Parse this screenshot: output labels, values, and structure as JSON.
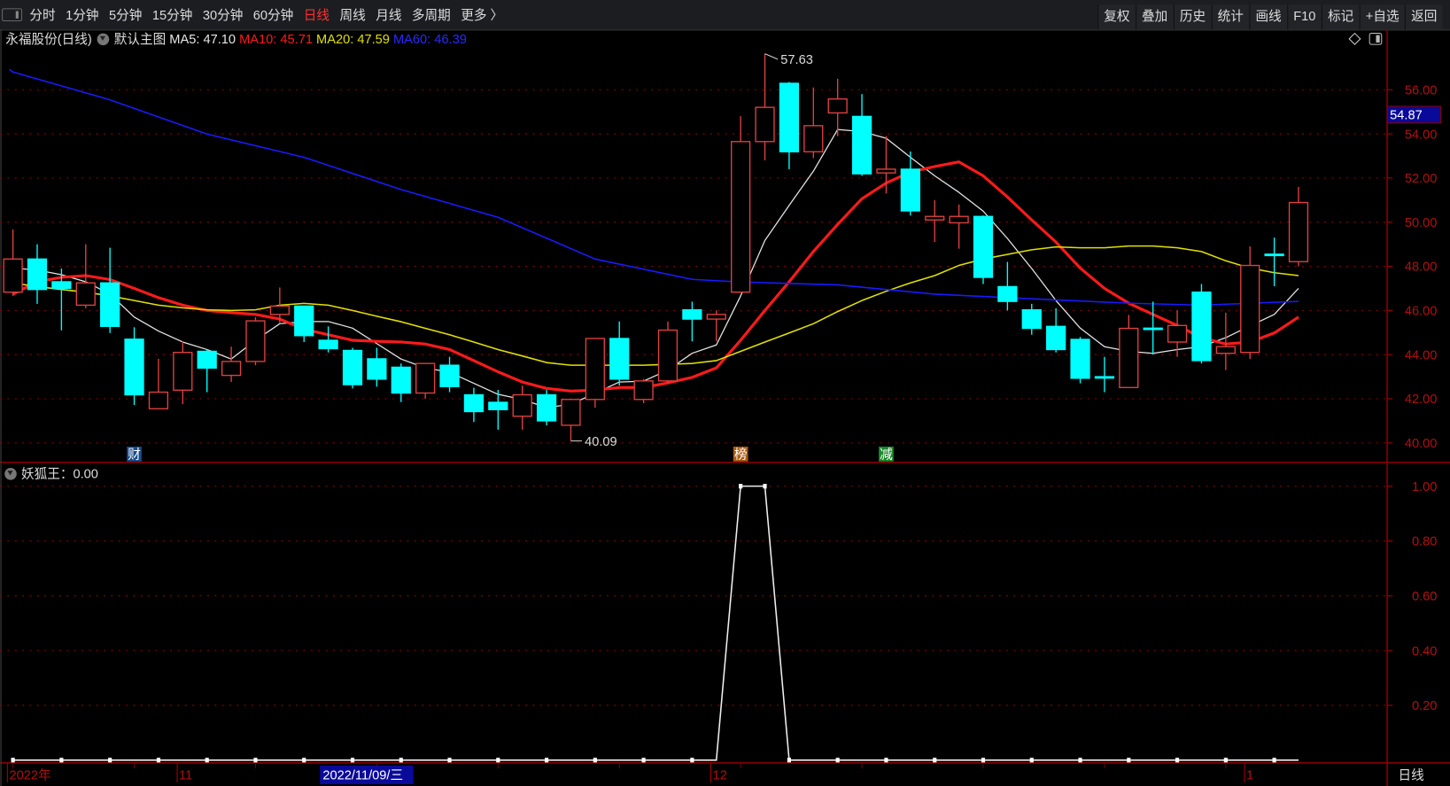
{
  "toolbar": {
    "periods": [
      "分时",
      "1分钟",
      "5分钟",
      "15分钟",
      "30分钟",
      "60分钟",
      "日线",
      "周线",
      "月线",
      "多周期",
      "更多 〉"
    ],
    "active_period": "日线",
    "buttons": [
      "复权",
      "叠加",
      "历史",
      "统计",
      "画线",
      "F10",
      "标记",
      "+自选",
      "返回"
    ]
  },
  "info": {
    "title": "永福股份(日线)",
    "template": "默认主图",
    "ma5": "MA5: 47.10",
    "ma10": "MA10: 45.71",
    "ma20": "MA20: 47.59",
    "ma60": "MA60: 46.39"
  },
  "indicator": {
    "label": "妖狐王：0.00"
  },
  "colors": {
    "up": "#e04040",
    "down": "#00ffff",
    "ma5": "#e6e6e6",
    "ma10": "#ff1a1a",
    "ma20": "#e0e000",
    "ma60": "#1a1aff",
    "grid": "#8b0000"
  },
  "chart_data": [
    {
      "type": "candlestick",
      "title": "永福股份(日线)",
      "ylim": [
        40,
        57
      ],
      "yticks": [
        "56.00",
        "54.00",
        "52.00",
        "50.00",
        "48.00",
        "46.00",
        "44.00",
        "42.00",
        "40.00"
      ],
      "current_price_tag": "54.87",
      "annotations": {
        "high": "57.63",
        "low": "40.09",
        "high_index": 31,
        "low_index": 23
      },
      "markers": [
        {
          "index": 5,
          "text": "财",
          "color": "#1a4a8a"
        },
        {
          "index": 30,
          "text": "榜",
          "color": "#b05a10"
        },
        {
          "index": 36,
          "text": "减",
          "color": "#1a8a2a"
        }
      ],
      "ohlc": [
        [
          46.83,
          49.67,
          46.66,
          48.33
        ],
        [
          48.33,
          49.0,
          46.3,
          46.95
        ],
        [
          47.3,
          47.9,
          45.1,
          47.0
        ],
        [
          46.24,
          49.0,
          46.1,
          47.25
        ],
        [
          47.25,
          48.84,
          44.98,
          45.28
        ],
        [
          44.7,
          45.24,
          41.72,
          42.18
        ],
        [
          41.55,
          43.81,
          41.55,
          42.3
        ],
        [
          42.39,
          44.6,
          41.76,
          44.1
        ],
        [
          44.15,
          44.23,
          42.3,
          43.39
        ],
        [
          43.06,
          44.36,
          42.76,
          43.69
        ],
        [
          43.69,
          45.7,
          43.52,
          45.53
        ],
        [
          45.82,
          47.04,
          45.4,
          46.2
        ],
        [
          46.2,
          46.2,
          44.57,
          44.86
        ],
        [
          44.65,
          45.28,
          44.1,
          44.27
        ],
        [
          44.19,
          44.31,
          42.47,
          42.64
        ],
        [
          43.81,
          44.31,
          42.55,
          42.89
        ],
        [
          43.43,
          43.6,
          41.85,
          42.26
        ],
        [
          42.26,
          43.6,
          42.0,
          43.6
        ],
        [
          43.52,
          43.9,
          42.3,
          42.55
        ],
        [
          42.18,
          42.5,
          40.95,
          41.42
        ],
        [
          41.84,
          42.4,
          40.6,
          41.51
        ],
        [
          41.21,
          42.6,
          40.6,
          42.18
        ],
        [
          42.18,
          42.4,
          40.8,
          41.0
        ],
        [
          40.8,
          41.9,
          40.09,
          41.97
        ],
        [
          41.97,
          44.73,
          41.6,
          44.73
        ],
        [
          44.73,
          45.5,
          42.6,
          42.89
        ],
        [
          41.97,
          42.9,
          41.8,
          42.81
        ],
        [
          42.81,
          45.5,
          42.7,
          45.11
        ],
        [
          46.03,
          46.4,
          44.6,
          45.61
        ],
        [
          45.61,
          46.0,
          44.6,
          45.82
        ],
        [
          46.83,
          54.8,
          46.83,
          53.65
        ],
        [
          53.65,
          57.63,
          52.8,
          55.2
        ],
        [
          56.29,
          56.35,
          52.4,
          53.19
        ],
        [
          53.19,
          56.1,
          52.9,
          54.37
        ],
        [
          54.95,
          56.5,
          53.9,
          55.58
        ],
        [
          54.79,
          55.8,
          52.1,
          52.19
        ],
        [
          52.23,
          53.9,
          51.3,
          52.4
        ],
        [
          52.4,
          53.2,
          50.3,
          50.51
        ],
        [
          50.1,
          51.0,
          49.1,
          50.26
        ],
        [
          49.97,
          50.8,
          48.8,
          50.26
        ],
        [
          50.26,
          50.3,
          47.2,
          47.5
        ],
        [
          47.08,
          48.2,
          46.0,
          46.41
        ],
        [
          46.03,
          46.3,
          44.9,
          45.19
        ],
        [
          45.28,
          46.1,
          44.1,
          44.23
        ],
        [
          44.69,
          44.8,
          42.7,
          42.93
        ],
        [
          43.0,
          43.9,
          42.3,
          42.95
        ],
        [
          42.51,
          45.8,
          42.51,
          45.19
        ],
        [
          45.2,
          46.4,
          44.0,
          45.15
        ],
        [
          44.57,
          46.0,
          43.9,
          45.32
        ],
        [
          46.83,
          47.2,
          43.6,
          43.73
        ],
        [
          44.06,
          45.9,
          43.3,
          44.36
        ],
        [
          44.1,
          48.9,
          43.8,
          48.04
        ],
        [
          48.55,
          49.3,
          47.1,
          48.5
        ],
        [
          48.21,
          51.6,
          48.0,
          50.89
        ]
      ],
      "series": [
        {
          "name": "MA5",
          "values": [
            47.92,
            47.83,
            47.62,
            47.3,
            46.74,
            45.7,
            45.07,
            44.57,
            44.23,
            43.8,
            44.65,
            45.4,
            45.5,
            45.5,
            45.2,
            44.5,
            43.8,
            43.4,
            43.2,
            42.7,
            42.2,
            41.97,
            41.6,
            41.75,
            42.25,
            42.76,
            42.8,
            43.3,
            44.06,
            44.44,
            46.66,
            49.17,
            50.76,
            52.31,
            54.2,
            54.1,
            53.8,
            52.94,
            52.1,
            51.35,
            50.5,
            49.26,
            47.9,
            46.45,
            45.2,
            44.36,
            44.15,
            44.06,
            44.23,
            44.36,
            44.77,
            45.3,
            45.82,
            47.0
          ]
        },
        {
          "name": "MA10",
          "values": [
            46.74,
            47.3,
            47.5,
            47.58,
            47.4,
            47.0,
            46.58,
            46.24,
            46.0,
            45.9,
            45.82,
            45.61,
            45.15,
            44.9,
            44.65,
            44.6,
            44.57,
            44.48,
            44.23,
            43.73,
            43.22,
            42.76,
            42.47,
            42.35,
            42.39,
            42.51,
            42.51,
            42.72,
            42.97,
            43.4,
            44.65,
            46.0,
            47.3,
            48.67,
            49.9,
            51.06,
            51.77,
            52.27,
            52.52,
            52.73,
            52.1,
            51.14,
            50.1,
            49.1,
            47.92,
            47.0,
            46.33,
            45.82,
            45.32,
            44.77,
            44.48,
            44.57,
            44.98,
            45.7
          ]
        },
        {
          "name": "MA20",
          "values": [
            47.25,
            47.08,
            46.95,
            46.83,
            46.66,
            46.45,
            46.24,
            46.12,
            46.03,
            46.0,
            46.03,
            46.24,
            46.32,
            46.24,
            46.0,
            45.74,
            45.49,
            45.19,
            44.9,
            44.57,
            44.23,
            43.94,
            43.64,
            43.52,
            43.52,
            43.52,
            43.52,
            43.56,
            43.6,
            43.73,
            44.15,
            44.57,
            44.98,
            45.4,
            45.95,
            46.45,
            46.87,
            47.25,
            47.58,
            48.04,
            48.33,
            48.54,
            48.75,
            48.88,
            48.84,
            48.84,
            48.92,
            48.92,
            48.84,
            48.67,
            48.25,
            47.92,
            47.71,
            47.58
          ]
        },
        {
          "name": "MA60",
          "points": [
            [
              0,
              56.8
            ],
            [
              4,
              55.54
            ],
            [
              8,
              53.99
            ],
            [
              12,
              52.94
            ],
            [
              16,
              51.48
            ],
            [
              20,
              50.22
            ],
            [
              24,
              48.33
            ],
            [
              28,
              47.41
            ],
            [
              30,
              47.29
            ],
            [
              34,
              47.16
            ],
            [
              38,
              46.74
            ],
            [
              42,
              46.53
            ],
            [
              46,
              46.33
            ],
            [
              49,
              46.24
            ],
            [
              53,
              46.41
            ]
          ]
        }
      ]
    },
    {
      "type": "line",
      "title": "妖狐王",
      "ylim": [
        0,
        1.1
      ],
      "yticks": [
        "1.00",
        "0.80",
        "0.60",
        "0.40",
        "0.20"
      ],
      "values": [
        0,
        0,
        0,
        0,
        0,
        0,
        0,
        0,
        0,
        0,
        0,
        0,
        0,
        0,
        0,
        0,
        0,
        0,
        0,
        0,
        0,
        0,
        0,
        0,
        0,
        0,
        0,
        0,
        0,
        0,
        1,
        1,
        0,
        0,
        0,
        0,
        0,
        0,
        0,
        0,
        0,
        0,
        0,
        0,
        0,
        0,
        0,
        0,
        0,
        0,
        0,
        0,
        0,
        0
      ]
    }
  ],
  "date_axis": {
    "labels": [
      "2022年",
      "11",
      "12",
      "1"
    ],
    "label_index": [
      0,
      7,
      29,
      51
    ],
    "crosshair_date": "2022/11/09/三",
    "period_label": "日线"
  }
}
